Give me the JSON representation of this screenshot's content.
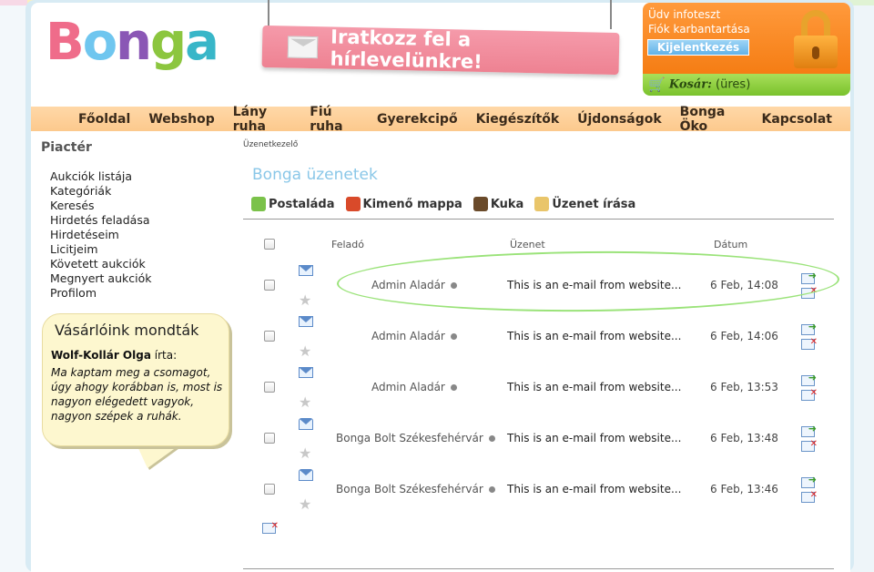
{
  "header": {
    "logo": [
      "B",
      "o",
      "n",
      "g",
      "a"
    ],
    "newsletter": "Iratkozz fel a hírlevelünkre!",
    "account_greeting": "Üdv infoteszt",
    "account_settings": "Fiók karbantartása",
    "logout_label": "Kijelentkezés",
    "cart_label": "Kosár:",
    "cart_value": "(üres)"
  },
  "nav": [
    "Főoldal",
    "Webshop",
    "Lány ruha",
    "Fiú ruha",
    "Gyerekcipő",
    "Kiegészítők",
    "Újdonságok",
    "Bonga Öko",
    "Kapcsolat"
  ],
  "sidebar": {
    "title": "Piactér",
    "items": [
      "Aukciók listája",
      "Kategóriák",
      "Keresés",
      "Hirdetés feladása",
      "Hirdetéseim",
      "Licitjeim",
      "Követett aukciók",
      "Megnyert aukciók",
      "Profilom"
    ],
    "testimonial": {
      "title": "Vásárlóink mondták",
      "author": "Wolf-Kollár Olga",
      "author_suffix": "írta:",
      "quote": "Ma kaptam meg a csomagot, úgy ahogy korábban is, most is nagyon elégedett vagyok, nagyon szépek a ruhák."
    }
  },
  "main": {
    "breadcrumb": "Üzenetkezelő",
    "title": "Bonga üzenetek",
    "toolbar": [
      "Postaláda",
      "Kimenő mappa",
      "Kuka",
      "Üzenet írása"
    ],
    "columns": {
      "sender": "Feladó",
      "message": "Üzenet",
      "date": "Dátum"
    },
    "rows": [
      {
        "sender": "Admin Aladár",
        "message": "This is an e-mail from website...",
        "date": "6 Feb, 14:08"
      },
      {
        "sender": "Admin Aladár",
        "message": "This is an e-mail from website...",
        "date": "6 Feb, 14:06"
      },
      {
        "sender": "Admin Aladár",
        "message": "This is an e-mail from website...",
        "date": "6 Feb, 13:53"
      },
      {
        "sender": "Bonga Bolt Székesfehérvár",
        "message": "This is an e-mail from website...",
        "date": "6 Feb, 13:48"
      },
      {
        "sender": "Bonga Bolt Székesfehérvár",
        "message": "This is an e-mail from website...",
        "date": "6 Feb, 13:46"
      }
    ]
  },
  "colors": {
    "accent": "#8ac7e8",
    "orange": "#f57d14",
    "green": "#79c22c",
    "highlight": "#9be37a"
  }
}
